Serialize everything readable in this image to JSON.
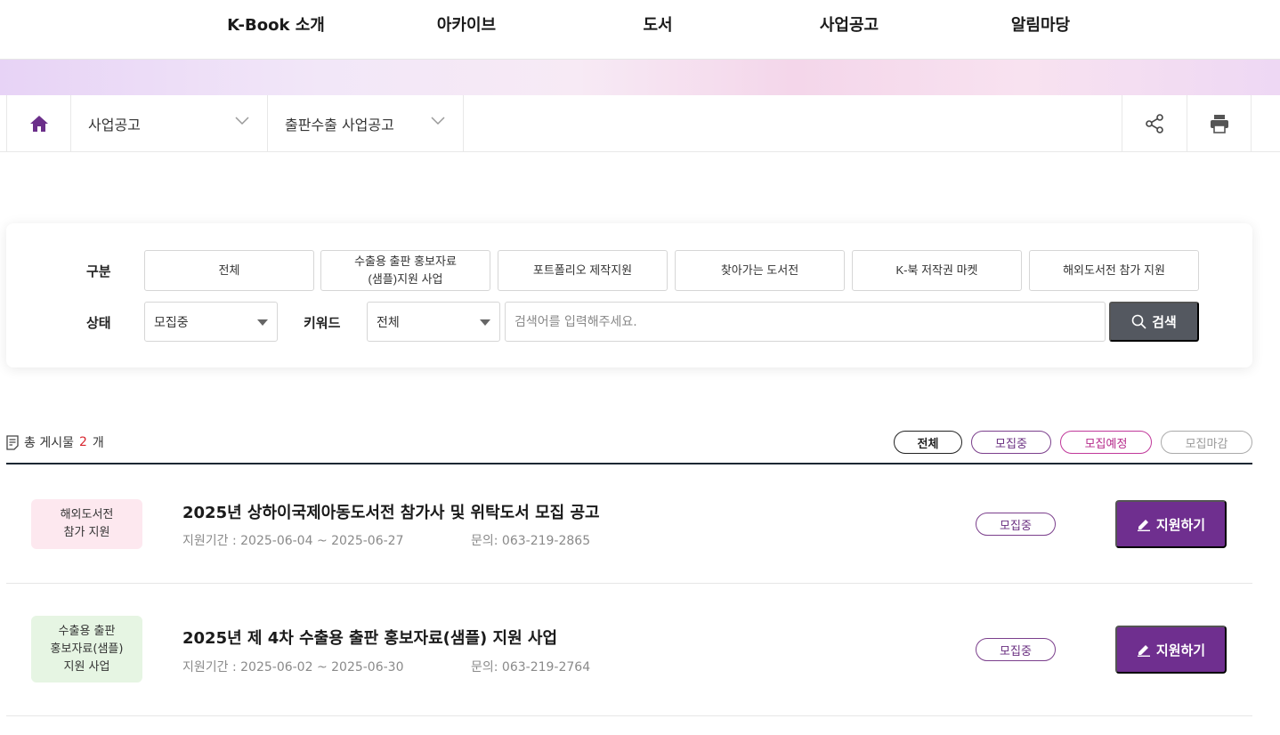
{
  "nav": {
    "items": [
      "K-Book 소개",
      "아카이브",
      "도서",
      "사업공고",
      "알림마당"
    ]
  },
  "breadcrumb": {
    "level1": "사업공고",
    "level2": "출판수출 사업공고"
  },
  "search": {
    "category_label": "구분",
    "categories": [
      "전체",
      "수출용 출판 홍보자료\n(샘플)지원 사업",
      "포트폴리오 제작지원",
      "찾아가는 도서전",
      "K-북 저작권 마켓",
      "해외도서전 참가 지원"
    ],
    "status_label": "상태",
    "status_value": "모집중",
    "keyword_label": "키워드",
    "keyword_scope": "전체",
    "placeholder": "검색어를 입력해주세요.",
    "button": "검색"
  },
  "list": {
    "count_prefix": "총 게시물",
    "count": "2",
    "count_suffix": "개",
    "filters": [
      "전체",
      "모집중",
      "모집예정",
      "모집마감"
    ]
  },
  "posts": [
    {
      "tag": "해외도서전\n참가 지원",
      "title": "2025년 상하이국제아동도서전 참가사 및 위탁도서 모집 공고",
      "period": "지원기간 : 2025-06-04 ~ 2025-06-27",
      "contact": "문의: 063-219-2865",
      "status": "모집중",
      "action": "지원하기"
    },
    {
      "tag": "수출용 출판\n홍보자료(샘플)\n지원 사업",
      "title": "2025년 제 4차 수출용 출판 홍보자료(샘플) 지원 사업",
      "period": "지원기간 : 2025-06-02 ~ 2025-06-30",
      "contact": "문의: 063-219-2764",
      "status": "모집중",
      "action": "지원하기"
    }
  ],
  "colors": {
    "accent_purple": "#6f2f8f",
    "tag_pink": "#fde8ef",
    "tag_green": "#e6f5e3",
    "search_button": "#545860",
    "count_red": "#d8262f"
  }
}
